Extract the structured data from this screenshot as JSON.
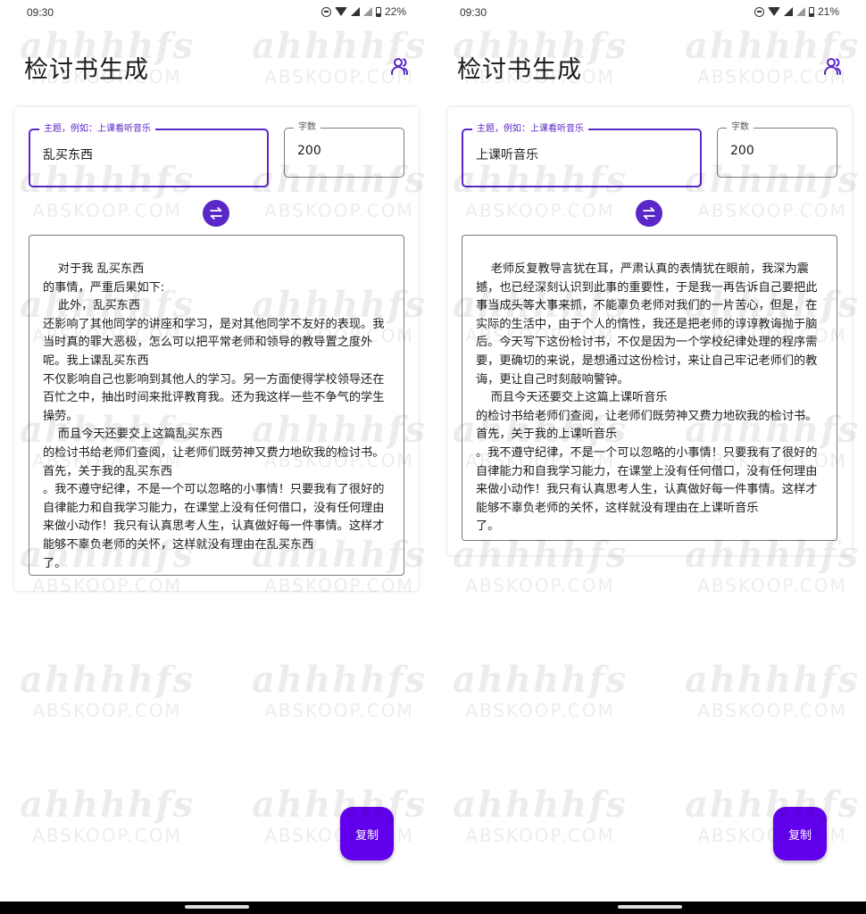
{
  "screens": [
    {
      "status": {
        "time": "09:30",
        "battery": "22%"
      },
      "title": "检讨书生成",
      "topic_field": {
        "label": "主题，例如：上课看听音乐",
        "value": "乱买东西"
      },
      "count_field": {
        "label": "字数",
        "value": "200"
      },
      "output_text": "    对于我 乱买东西\n的事情，严重后果如下:\n    此外，乱买东西\n还影响了其他同学的讲座和学习，是对其他同学不友好的表现。我当时真的罪大恶极，怎么可以把平常老师和领导的教导置之度外呢。我上课乱买东西\n不仅影响自己也影响到其他人的学习。另一方面使得学校领导还在百忙之中，抽出时间来批评教育我。还为我这样一些不争气的学生操劳。\n    而且今天还要交上这篇乱买东西\n的检讨书给老师们查阅，让老师们既劳神又费力地砍我的检讨书。首先，关于我的乱买东西\n。我不遵守纪律，不是一个可以忽略的小事情！只要我有了很好的自律能力和自我学习能力，在课堂上没有任何借口，没有任何理由来做小动作！我只有认真思考人生，认真做好每一件事情。这样才能够不辜负老师的关怀，这样就没有理由在乱买东西\n了。",
      "copy_button": "复制"
    },
    {
      "status": {
        "time": "09:30",
        "battery": "21%"
      },
      "title": "检讨书生成",
      "topic_field": {
        "label": "主题，例如：上课看听音乐",
        "value": "上课听音乐"
      },
      "count_field": {
        "label": "字数",
        "value": "200"
      },
      "output_text": "    老师反复教导言犹在耳，严肃认真的表情犹在眼前，我深为震撼，也已经深刻认识到此事的重要性，于是我一再告诉自己要把此事当成头等大事来抓，不能辜负老师对我们的一片苦心，但是，在实际的生活中，由于个人的惰性，我还是把老师的谆谆教诲抛于脑后。今天写下这份检讨书，不仅是因为一个学校纪律处理的程序需要，更确切的来说，是想通过这份检讨，来让自己牢记老师们的教诲，更让自己时刻敲响警钟。\n    而且今天还要交上这篇上课听音乐\n的检讨书给老师们查阅，让老师们既劳神又费力地砍我的检讨书。首先，关于我的上课听音乐\n。我不遵守纪律，不是一个可以忽略的小事情！只要我有了很好的自律能力和自我学习能力，在课堂上没有任何借口，没有任何理由来做小动作！我只有认真思考人生，认真做好每一件事情。这样才能够不辜负老师的关怀，这样就没有理由在上课听音乐\n了。",
      "copy_button": "复制"
    }
  ],
  "watermark": {
    "brand": "ahhhhfs",
    "site": "ABSKOOP.COM"
  },
  "colors": {
    "accent": "#5a27c8",
    "fab": "#6200ee"
  },
  "icons": [
    "dnd-icon",
    "wifi-icon",
    "signal-icon",
    "battery-icon",
    "people-icon",
    "swap-icon"
  ]
}
